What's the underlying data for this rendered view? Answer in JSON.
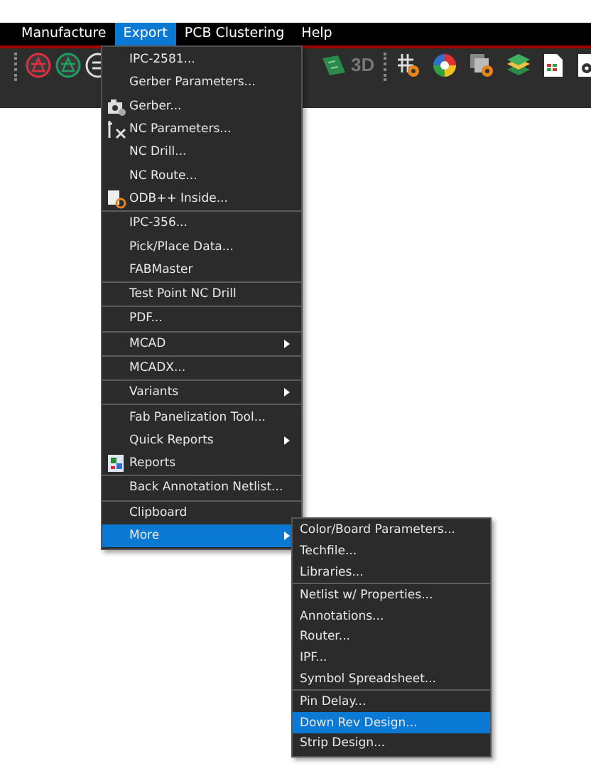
{
  "menubar": [
    {
      "label": "Manufacture",
      "selected": false
    },
    {
      "label": "Export",
      "selected": true
    },
    {
      "label": "PCB Clustering",
      "selected": false
    },
    {
      "label": "Help",
      "selected": false
    }
  ],
  "toolbar": {
    "text_3d": "3D"
  },
  "export_menu": {
    "groups": [
      {
        "items": [
          {
            "label": "IPC-2581...",
            "kind": "plain",
            "submenu": false,
            "selected": false
          },
          {
            "label": "Gerber Parameters...",
            "kind": "plain",
            "submenu": false,
            "selected": false
          },
          {
            "label": "Gerber...",
            "kind": "camera",
            "submenu": false,
            "selected": false
          },
          {
            "label": "NC Parameters...",
            "kind": "tools",
            "submenu": false,
            "selected": false
          },
          {
            "label": "NC Drill...",
            "kind": "plain",
            "submenu": false,
            "selected": false
          },
          {
            "label": "NC Route...",
            "kind": "plain",
            "submenu": false,
            "selected": false
          },
          {
            "label": "ODB++ Inside...",
            "kind": "doc",
            "submenu": false,
            "selected": false
          }
        ]
      },
      {
        "items": [
          {
            "label": "IPC-356...",
            "kind": "plain",
            "submenu": false,
            "selected": false
          },
          {
            "label": "Pick/Place Data...",
            "kind": "plain",
            "submenu": false,
            "selected": false
          },
          {
            "label": "FABMaster",
            "kind": "plain",
            "submenu": false,
            "selected": false
          }
        ]
      },
      {
        "items": [
          {
            "label": "Test Point NC Drill",
            "kind": "plain",
            "submenu": false,
            "selected": false
          }
        ]
      },
      {
        "items": [
          {
            "label": "PDF...",
            "kind": "plain",
            "submenu": false,
            "selected": false
          }
        ]
      },
      {
        "items": [
          {
            "label": "MCAD",
            "kind": "plain",
            "submenu": true,
            "selected": false
          }
        ]
      },
      {
        "items": [
          {
            "label": "MCADX...",
            "kind": "plain",
            "submenu": false,
            "selected": false
          }
        ]
      },
      {
        "items": [
          {
            "label": "Variants",
            "kind": "plain",
            "submenu": true,
            "selected": false
          }
        ]
      },
      {
        "items": [
          {
            "label": "Fab Panelization Tool...",
            "kind": "plain",
            "submenu": false,
            "selected": false
          },
          {
            "label": "Quick Reports",
            "kind": "plain",
            "submenu": true,
            "selected": false
          },
          {
            "label": "Reports",
            "kind": "report",
            "submenu": false,
            "selected": false
          }
        ]
      },
      {
        "items": [
          {
            "label": "Back Annotation Netlist...",
            "kind": "plain",
            "submenu": false,
            "selected": false
          }
        ]
      },
      {
        "items": [
          {
            "label": "Clipboard",
            "kind": "plain",
            "submenu": false,
            "selected": false
          },
          {
            "label": "More",
            "kind": "plain",
            "submenu": true,
            "selected": true
          }
        ]
      }
    ]
  },
  "more_submenu": {
    "groups": [
      {
        "items": [
          {
            "label": "Color/Board Parameters...",
            "selected": false
          },
          {
            "label": "Techfile...",
            "selected": false
          },
          {
            "label": "Libraries...",
            "selected": false
          }
        ]
      },
      {
        "items": [
          {
            "label": "Netlist w/ Properties...",
            "selected": false
          },
          {
            "label": "Annotations...",
            "selected": false
          },
          {
            "label": "Router...",
            "selected": false
          },
          {
            "label": "IPF...",
            "selected": false
          },
          {
            "label": "Symbol Spreadsheet...",
            "selected": false
          }
        ]
      },
      {
        "items": [
          {
            "label": "Pin Delay...",
            "selected": false
          },
          {
            "label": "Down Rev Design...",
            "selected": true
          },
          {
            "label": "Strip Design...",
            "selected": false
          }
        ]
      }
    ]
  }
}
